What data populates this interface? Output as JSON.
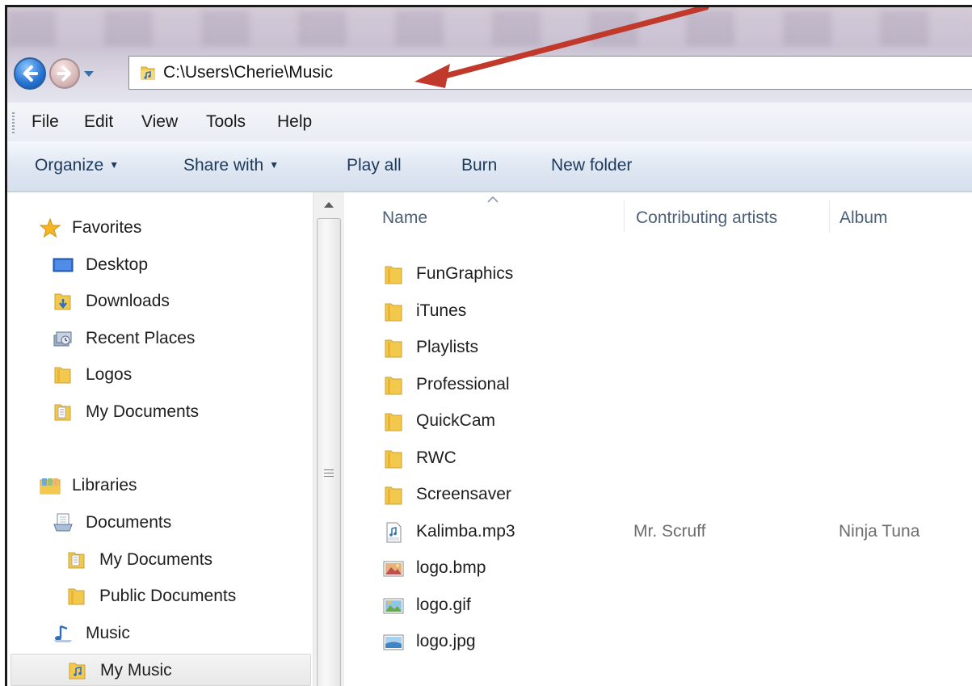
{
  "window": {
    "address_path": "C:\\Users\\Cherie\\Music"
  },
  "menubar": {
    "items": [
      "File",
      "Edit",
      "View",
      "Tools",
      "Help"
    ]
  },
  "commandbar": {
    "organize": "Organize",
    "share_with": "Share with",
    "play_all": "Play all",
    "burn": "Burn",
    "new_folder": "New folder"
  },
  "navpane": {
    "favorites": {
      "label": "Favorites",
      "items": [
        "Desktop",
        "Downloads",
        "Recent Places",
        "Logos",
        "My Documents"
      ]
    },
    "libraries": {
      "label": "Libraries",
      "documents": "Documents",
      "documents_children": [
        "My Documents",
        "Public Documents"
      ],
      "music": "Music",
      "music_children": [
        "My Music"
      ]
    },
    "selected": "My Music"
  },
  "filelist": {
    "columns": [
      "Name",
      "Contributing artists",
      "Album"
    ],
    "rows": [
      {
        "name": "FunGraphics",
        "type": "folder",
        "artist": "",
        "album": ""
      },
      {
        "name": "iTunes",
        "type": "folder",
        "artist": "",
        "album": ""
      },
      {
        "name": "Playlists",
        "type": "folder",
        "artist": "",
        "album": ""
      },
      {
        "name": "Professional",
        "type": "folder",
        "artist": "",
        "album": ""
      },
      {
        "name": "QuickCam",
        "type": "folder",
        "artist": "",
        "album": ""
      },
      {
        "name": "RWC",
        "type": "folder",
        "artist": "",
        "album": ""
      },
      {
        "name": "Screensaver",
        "type": "folder",
        "artist": "",
        "album": ""
      },
      {
        "name": "Kalimba.mp3",
        "type": "mp3",
        "artist": "Mr. Scruff",
        "album": "Ninja Tuna"
      },
      {
        "name": "logo.bmp",
        "type": "bmp",
        "artist": "",
        "album": ""
      },
      {
        "name": "logo.gif",
        "type": "gif",
        "artist": "",
        "album": ""
      },
      {
        "name": "logo.jpg",
        "type": "jpg",
        "artist": "",
        "album": ""
      }
    ]
  },
  "colors": {
    "annotation_arrow": "#c0392b",
    "command_text": "#1e395b",
    "column_header_text": "#4c607a",
    "folder_yellow": "#f2c94c"
  }
}
